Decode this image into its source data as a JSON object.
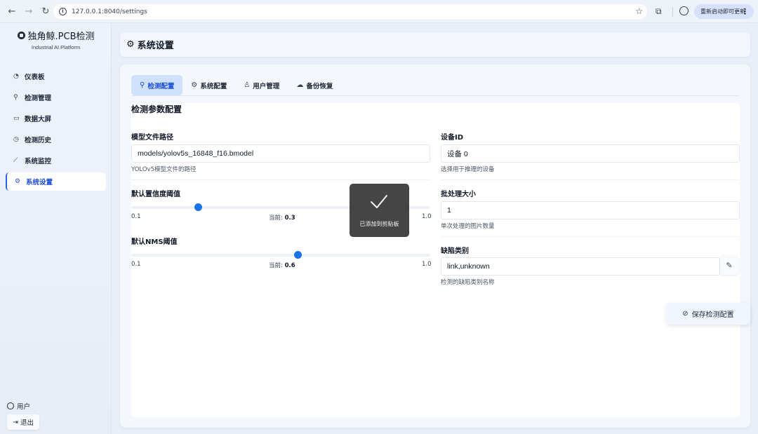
{
  "browser": {
    "url": "127.0.0.1:8040/settings",
    "update_label": "重新启动即可更新"
  },
  "sidebar": {
    "brand_title": "独角鲸.PCB检测",
    "brand_subtitle": "Industrial AI Platform",
    "items": [
      {
        "label": "仪表板",
        "icon": "dashboard-icon"
      },
      {
        "label": "检测管理",
        "icon": "search-icon"
      },
      {
        "label": "数据大屏",
        "icon": "screen-icon"
      },
      {
        "label": "检测历史",
        "icon": "history-icon"
      },
      {
        "label": "系统监控",
        "icon": "chart-icon"
      },
      {
        "label": "系统设置",
        "icon": "gear-icon",
        "active": true
      }
    ],
    "user_label": "用户",
    "logout_label": "退出"
  },
  "header": {
    "title": "系统设置"
  },
  "tabs": [
    {
      "label": "检测配置",
      "icon": "search-icon",
      "active": true
    },
    {
      "label": "系统配置",
      "icon": "gear-icon"
    },
    {
      "label": "用户管理",
      "icon": "user-icon"
    },
    {
      "label": "备份恢复",
      "icon": "cloud-icon"
    }
  ],
  "form": {
    "section_title": "检测参数配置",
    "model_path": {
      "label": "模型文件路径",
      "value": "models/yolov5s_16848_f16.bmodel",
      "hint": "YOLOv5模型文件的路径"
    },
    "device_id": {
      "label": "设备ID",
      "value": "设备 0",
      "hint": "选择用于推理的设备"
    },
    "confidence": {
      "label": "默认置信度阈值",
      "min": "0.1",
      "max": "1.0",
      "current_prefix": "当前: ",
      "current": "0.3",
      "value": 0.3,
      "range": [
        0.1,
        1.0
      ]
    },
    "nms": {
      "label": "默认NMS阈值",
      "min": "0.1",
      "max": "1.0",
      "current_prefix": "当前: ",
      "current": "0.6",
      "value": 0.6,
      "range": [
        0.1,
        1.0
      ]
    },
    "batch_size": {
      "label": "批处理大小",
      "value": "1",
      "hint": "单次处理的图片数量"
    },
    "defect_classes": {
      "label": "缺陷类别",
      "value": "link,unknown",
      "hint": "检测的缺陷类别名称"
    },
    "save_label": "保存检测配置"
  },
  "toast": {
    "text": "已添加到剪贴板"
  },
  "colors": {
    "accent": "#1a73e8",
    "active_tab_bg": "#cfe1fb"
  }
}
